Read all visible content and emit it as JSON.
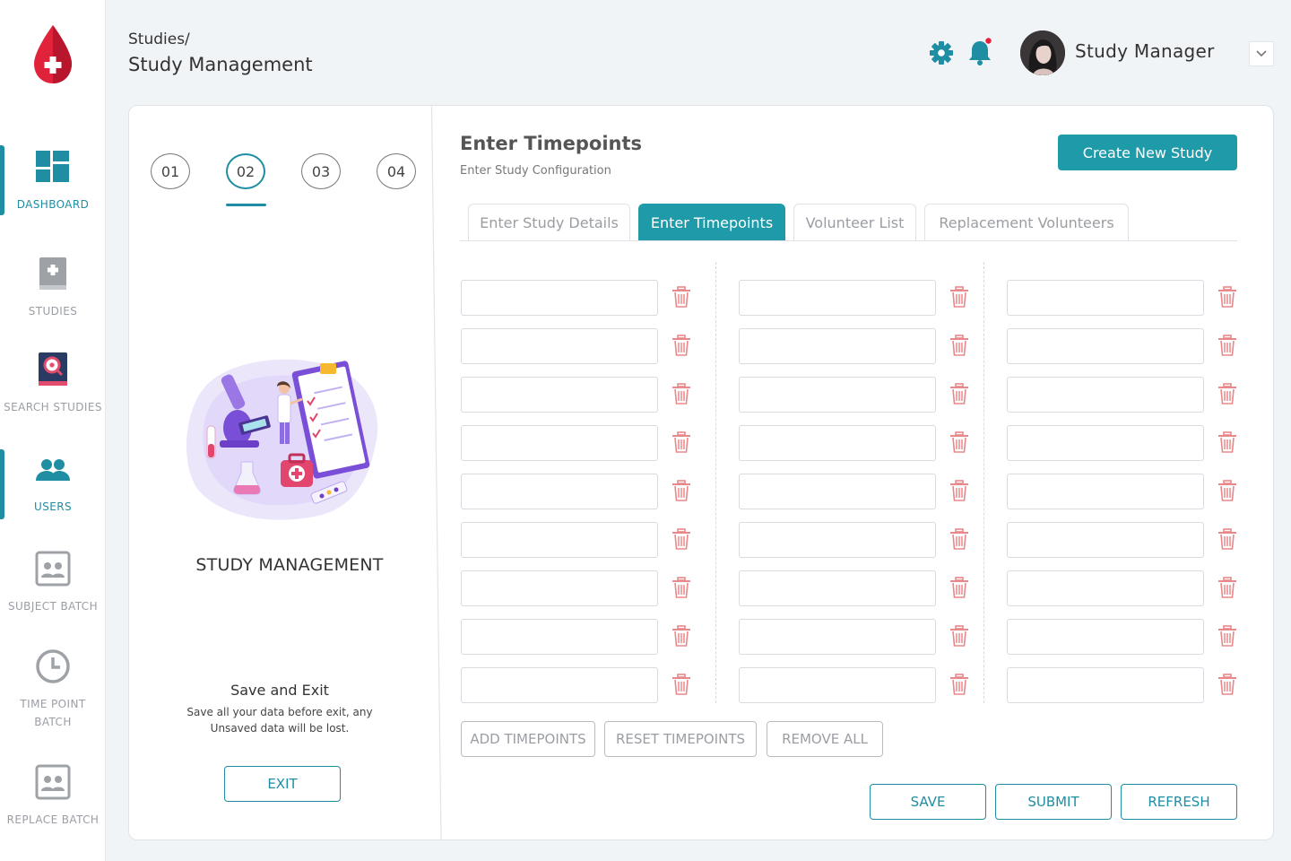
{
  "sidebar": {
    "items": [
      {
        "label": "DASHBOARD",
        "icon": "dashboard-icon"
      },
      {
        "label": "STUDIES",
        "icon": "book-icon"
      },
      {
        "label": "SEARCH STUDIES",
        "icon": "search-book-icon"
      },
      {
        "label": "USERS",
        "icon": "users-icon"
      },
      {
        "label": "SUBJECT BATCH",
        "icon": "subject-batch-icon"
      },
      {
        "label": "TIME POINT BATCH",
        "icon": "clock-icon"
      },
      {
        "label": "REPLACE BATCH",
        "icon": "replace-batch-icon"
      }
    ]
  },
  "header": {
    "breadcrumb": "Studies/",
    "title": "Study Management",
    "user_name": "Study Manager"
  },
  "steps": [
    "01",
    "02",
    "03",
    "04"
  ],
  "left": {
    "title": "STUDY MANAGEMENT",
    "save_exit_title": "Save and Exit",
    "save_exit_text": "Save all your data before exit, any Unsaved data will be lost.",
    "exit_label": "EXIT"
  },
  "main": {
    "title": "Enter Timepoints",
    "subtitle": "Enter Study Configuration",
    "create_label": "Create New Study",
    "tabs": [
      "Enter Study Details",
      "Enter Timepoints",
      "Volunteer List",
      "Replacement Volunteers"
    ],
    "add_label": "ADD TIMEPOINTS",
    "reset_label": "RESET TIMEPOINTS",
    "remove_label": "REMOVE ALL",
    "save_label": "SAVE",
    "submit_label": "SUBMIT",
    "refresh_label": "REFRESH"
  },
  "colors": {
    "accent": "#1f8ea3",
    "accent_fill": "#1f9aa9",
    "delete": "#e8888a",
    "brand_red": "#e0223a"
  }
}
